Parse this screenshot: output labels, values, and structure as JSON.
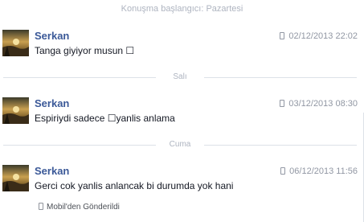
{
  "conversation": {
    "start_label": "Konuşma başlangıcı: Pazartesi"
  },
  "dividers": [
    "Salı",
    "Cuma"
  ],
  "messages": [
    {
      "sender": "Serkan",
      "text": "Tanga giyiyor musun ☐",
      "timestamp": "02/12/2013 22:02"
    },
    {
      "sender": "Serkan",
      "text": "Espiriydi sadece ☐yanlis anlama",
      "timestamp": "03/12/2013 08:30"
    },
    {
      "sender": "Serkan",
      "text": "Gerci cok yanlis anlancak bi durumda yok hani",
      "timestamp": "06/12/2013 11:56"
    }
  ],
  "mobile_note": "Mobil'den Gönderildi",
  "colors": {
    "sender": "#3b5998",
    "muted": "#9197a3",
    "divider": "#dde1e8"
  }
}
